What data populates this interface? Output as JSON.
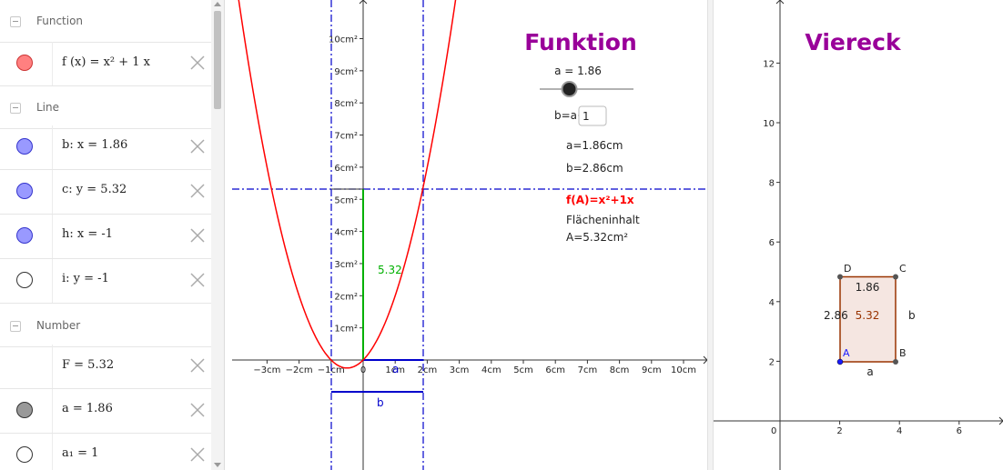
{
  "algebra": {
    "categories": {
      "function": "Function",
      "line": "Line",
      "number": "Number"
    },
    "items": {
      "f": {
        "expr": "f (x)  =  x² + 1 x",
        "color": "#ff8080"
      },
      "b": {
        "expr": "b: x = 1.86",
        "color": "#9999ff"
      },
      "c": {
        "expr": "c: y = 5.32",
        "color": "#9999ff"
      },
      "h": {
        "expr": "h: x = -1",
        "color": "#9999ff"
      },
      "i": {
        "expr": "i: y = -1",
        "color": "#ffffff"
      },
      "F": {
        "expr": "F = 5.32"
      },
      "a": {
        "expr": "a = 1.86",
        "color": "#999999"
      },
      "a1": {
        "expr": "a₁ = 1",
        "color": "#ffffff"
      }
    }
  },
  "graphics1": {
    "title": "Funktion",
    "slider_label": "a = 1.86",
    "slider_value": 1.86,
    "b_input_label": "b=a+",
    "b_input_value": "1",
    "a_text": "a=1.86cm",
    "b_text": "b=2.86cm",
    "function_text": "f(A)=x²+1x",
    "area_label": "Flächeninhalt",
    "area_value": "A=5.32cm²",
    "segment_label": "5.32",
    "seg_a_label": "a",
    "seg_b_label": "b",
    "x_ticks": [
      "−3cm",
      "−2cm",
      "−1cm",
      "0",
      "1cm",
      "2cm",
      "3cm",
      "4cm",
      "5cm",
      "6cm",
      "7cm",
      "8cm",
      "9cm",
      "10cm"
    ],
    "y_ticks": [
      "1cm²",
      "2cm²",
      "3cm²",
      "4cm²",
      "5cm²",
      "6cm²",
      "7cm²",
      "8cm²",
      "9cm²",
      "10cm²"
    ],
    "colors": {
      "curve": "#ff0000",
      "lines": "#0000cc",
      "segment": "#00b000",
      "title": "#990099",
      "function_text": "#ff0000"
    }
  },
  "graphics2": {
    "title": "Viereck",
    "x_ticks": [
      "2",
      "4",
      "6"
    ],
    "y_ticks": [
      "2",
      "4",
      "6",
      "8",
      "10",
      "12"
    ],
    "origin": "0",
    "points": {
      "A": "A",
      "B": "B",
      "C": "C",
      "D": "D"
    },
    "side_top": "1.86",
    "side_left": "2.86",
    "side_right": "b",
    "side_bottom": "a",
    "area": "5.32",
    "colors": {
      "rect_fill": "#f5e6e1",
      "rect_stroke": "#993300",
      "area_text": "#993300",
      "title": "#990099"
    }
  }
}
